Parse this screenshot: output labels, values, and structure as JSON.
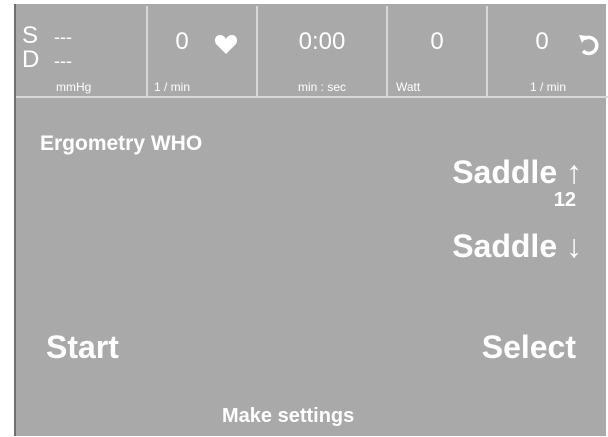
{
  "header": {
    "blood_pressure": {
      "sys_letter": "S",
      "sys_value": "---",
      "dia_letter": "D",
      "dia_value": "---",
      "unit": "mmHg"
    },
    "heart_rate": {
      "value": "0",
      "unit": "1 / min",
      "icon": "heart-icon"
    },
    "time": {
      "value": "0:00",
      "unit": "min : sec"
    },
    "power": {
      "value": "0",
      "unit": "Watt"
    },
    "cadence": {
      "value": "0",
      "unit": "1 / min",
      "icon": "rotation-icon"
    }
  },
  "main": {
    "title": "Ergometry WHO",
    "saddle_up": "Saddle ↑",
    "saddle_value": "12",
    "saddle_down": "Saddle ↓",
    "start": "Start",
    "select": "Select",
    "status": "Make settings"
  },
  "colors": {
    "screen_bg": "#a9a9a9",
    "text": "#ffffff",
    "divider": "#d7d7d7"
  }
}
